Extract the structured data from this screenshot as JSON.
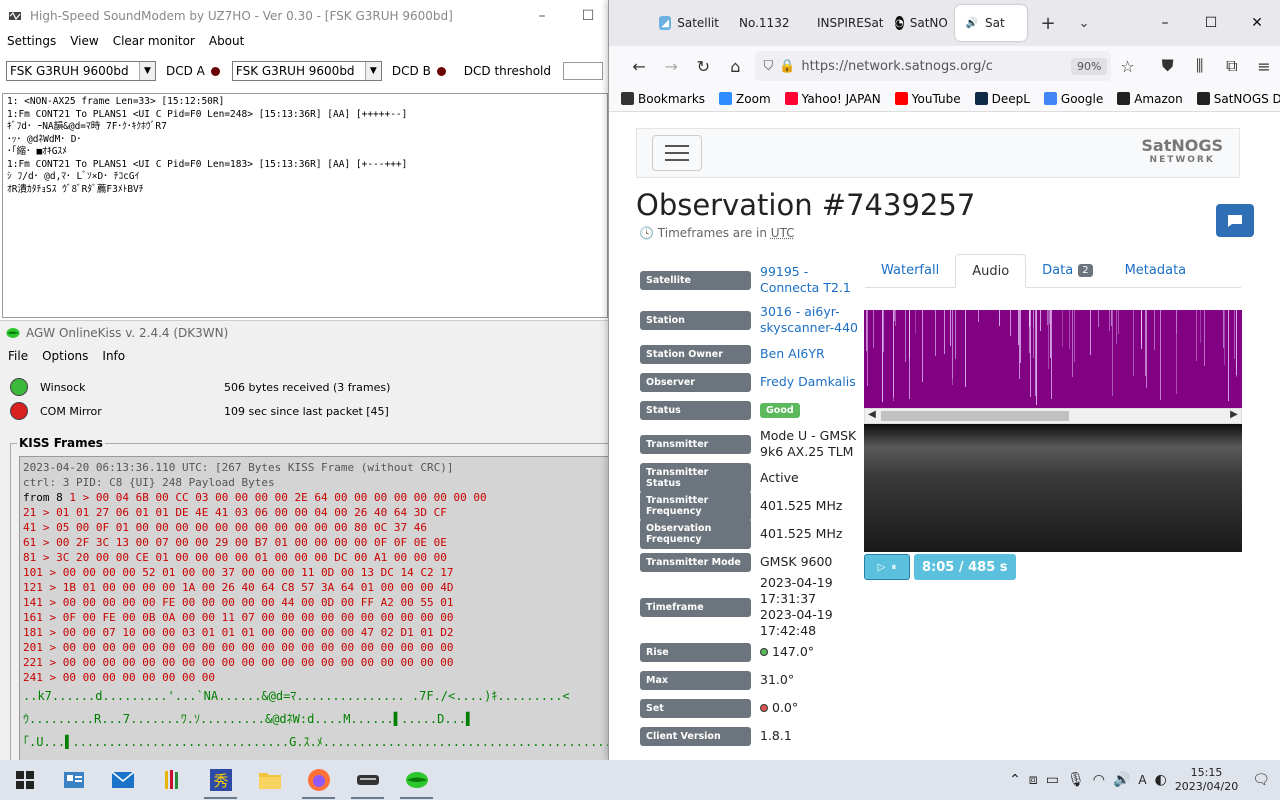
{
  "soundmodem": {
    "title": "High-Speed SoundModem by UZ7HO - Ver 0.30 - [FSK G3RUH 9600bd]",
    "controls": {
      "minimize": "–",
      "maximize": "☐"
    },
    "menu": [
      "Settings",
      "View",
      "Clear monitor",
      "About"
    ],
    "modem_a": "FSK G3RUH 9600bd",
    "dcd_a": "DCD A",
    "modem_b": "FSK G3RUH 9600bd",
    "dcd_b": "DCD B",
    "dcd_threshold": "DCD threshold",
    "monitor_lines": [
      "1: <NON-AX25 frame Len=33> [15:12:50R]",
      "1:Fm CONT21 To PLANS1 <UI C Pid=F0 Len=248> [15:13:36R] [AA] [+++++--]",
      "ｷﾞﾌd･ ｰNA韻&@d=ﾏ時 7F･ｸ･ｷｸﾎｳﾞR7",
      "･ｯ･ @dﾈWdM･ D･",
      "･｢縮･ ■ｵｷGｽﾒ",
      "1:Fm CONT21 To PLANS1 <UI C Pid=F0 Len=183> [15:13:36R] [AA] [+---+++]",
      "ｼ ﾌ/d･ @d,ﾏ･ Lﾞｿ×D･ ﾁｺcGｲ",
      "ｵR潰ｶﾀﾁｮSｽ ｳﾞ8ﾞRﾀﾞ薦F3ﾒﾄBVﾁ"
    ]
  },
  "agw": {
    "title": "AGW OnlineKiss v. 2.4.4  (DK3WN)",
    "menu": [
      "File",
      "Options",
      "Info"
    ],
    "status": [
      {
        "name": "Winsock",
        "info": "506 bytes received (3 frames)",
        "color": "#3cb83c"
      },
      {
        "name": "COM Mirror",
        "info": "109 sec since last packet [45]",
        "color": "#d82020"
      }
    ],
    "frames_label": "KISS Frames",
    "header_lines": [
      "2023-04-20 06:13:36.110 UTC: [267 Bytes KISS Frame (without CRC)]",
      "ctrl: 3   PID: C8 {UI}   248 Payload Bytes"
    ],
    "from_label": "from 8",
    "hex_lines": [
      "  1 > 00 04 6B 00 CC 03 00 00 00 00 2E 64 00 00 00 00 00 00 00 00",
      " 21 > 01 01 27 06 01 01 DE 4E 41 03 06 00 00 04 00 26 40 64 3D CF",
      " 41 > 05 00 0F 01 00 00 00 00 00 00 00 00 00 00 00 80 0C 37 46",
      " 61 > 00 2F 3C 13 00 07 00 00 29 00 B7 01 00 00 00 00 0F 0F 0E 0E",
      " 81 > 3C 20 00 00 CE 01 00 00 00 00 01 00 00 00 DC 00 A1 00 00 00",
      "101 > 00 00 00 00 52 01 00 00 37 00 00 00 11 0D 00 13 DC 14 C2 17",
      "121 > 1B 01 00 00 00 00 1A 00 26 40 64 C8 57 3A 64 01 00 00 00 4D",
      "141 > 00 00 00 00 00 FE 00 00 00 00 00 44 00 0D 00 FF A2 00 55 01",
      "161 > 0F 00 FE 00 0B 0A 00 00 11 07 00 00 00 00 00 00 00 00 00 00",
      "181 > 00 00 07 10 00 00 03 01 01 01 00 00 00 00 00 47 02 D1 01 D2",
      "201 > 00 00 00 00 00 00 00 00 00 00 00 00 00 00 00 00 00 00 00 00",
      "221 > 00 00 00 00 00 00 00 00 00 00 00 00 00 00 00 00 00 00 00 00",
      "241 > 00 00 00 00 00 00 00 00"
    ],
    "ascii_lines": [
      "..k7......d.........'...`NA......&@d=ﾏ...............  .7F./<....)ｷ.........<",
      "ｳ.........R...7.......ﾜ.ｿ.........&@dﾈW:d....M......▌.....D...▌",
      "｢.U...▌..............................G.ｽ.ﾒ........................................"
    ]
  },
  "firefox": {
    "tabs": [
      {
        "label": "Satellit",
        "icon": "satellite-icon"
      },
      {
        "label": "No.1132",
        "icon": "page-icon"
      },
      {
        "label": "INSPIRESat",
        "icon": "page-icon"
      },
      {
        "label": "SatNO",
        "icon": "satnogs-icon"
      },
      {
        "label": "Sat",
        "icon": "speaker-icon"
      }
    ],
    "url": "https://network.satnogs.org/c",
    "zoom": "90%",
    "bookmarks": [
      {
        "label": "Bookmarks",
        "color": "#333333"
      },
      {
        "label": "Zoom",
        "color": "#2d8cff"
      },
      {
        "label": "Yahoo! JAPAN",
        "color": "#ff0033"
      },
      {
        "label": "YouTube",
        "color": "#ff0000"
      },
      {
        "label": "DeepL",
        "color": "#0f2b46"
      },
      {
        "label": "Google",
        "color": "#4285f4"
      },
      {
        "label": "Amazon",
        "color": "#222222"
      },
      {
        "label": "SatNOGS DB",
        "color": "#222222"
      }
    ],
    "page": {
      "logo_line1": "SatNOGS",
      "logo_line2": "NETWORK",
      "title": "Observation #7439257",
      "timeframe_note": "Timeframes are in",
      "timeframe_tz": "UTC",
      "details": [
        {
          "label": "Satellite",
          "value": "99195 - Connecta T2.1",
          "link": true
        },
        {
          "label": "Station",
          "value": "3016 - ai6yr-skyscanner-440",
          "link": true
        },
        {
          "label": "Station Owner",
          "value": "Ben AI6YR",
          "link": true
        },
        {
          "label": "Observer",
          "value": "Fredy Damkalis",
          "link": true
        },
        {
          "label": "Status",
          "value": "Good",
          "badge": true
        },
        {
          "label": "Transmitter",
          "value": "Mode U - GMSK 9k6 AX.25 TLM"
        },
        {
          "label": "Transmitter Status",
          "value": "Active"
        },
        {
          "label": "Transmitter Frequency",
          "value": "401.525 MHz"
        },
        {
          "label": "Observation Frequency",
          "value": "401.525 MHz"
        },
        {
          "label": "Transmitter Mode",
          "value": "GMSK 9600"
        },
        {
          "label": "Timeframe",
          "value": "2023-04-19 17:31:37",
          "value2": "2023-04-19 17:42:48"
        },
        {
          "label": "Rise",
          "value": "147.0°",
          "dot": "#5cb85c"
        },
        {
          "label": "Max",
          "value": "31.0°"
        },
        {
          "label": "Set",
          "value": "0.0°",
          "dot": "#d9534f"
        },
        {
          "label": "Client Version",
          "value": "1.8.1"
        }
      ],
      "tabs": [
        {
          "label": "Waterfall"
        },
        {
          "label": "Audio",
          "active": true
        },
        {
          "label": "Data",
          "count": "2"
        },
        {
          "label": "Metadata"
        }
      ],
      "audio_time": "8:05 / 485 s",
      "audio_progress": 0.97
    }
  },
  "taskbar": {
    "time": "15:15",
    "date": "2023/04/20"
  }
}
